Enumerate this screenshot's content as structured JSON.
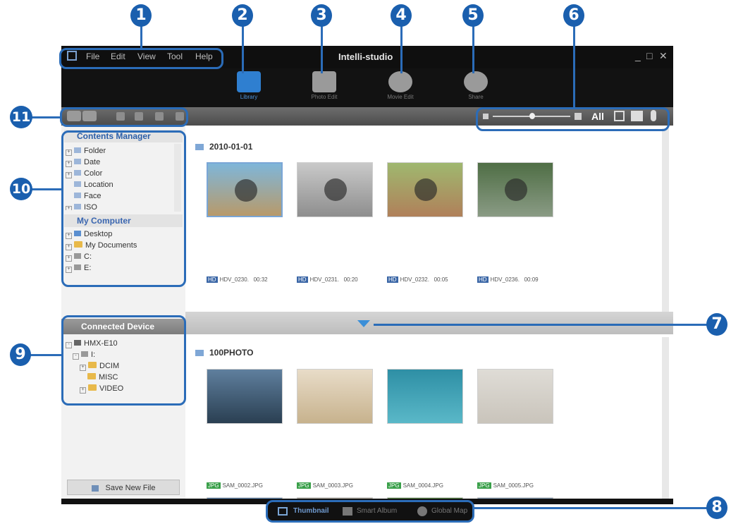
{
  "menu": {
    "items": [
      "File",
      "Edit",
      "View",
      "Tool",
      "Help"
    ]
  },
  "window": {
    "title": "Intelli-studio"
  },
  "modes": [
    {
      "label": "Library",
      "icon": "library-icon",
      "color": "#2f7fd0"
    },
    {
      "label": "Photo Edit",
      "icon": "photo-edit-icon",
      "color": "#9a9a9a"
    },
    {
      "label": "Movie Edit",
      "icon": "movie-edit-icon",
      "color": "#9a9a9a"
    },
    {
      "label": "Share",
      "icon": "share-globe-icon",
      "color": "#9a9a9a"
    }
  ],
  "view_filter": {
    "all_label": "All"
  },
  "left": {
    "contents_manager": {
      "title": "Contents Manager",
      "items": [
        "Folder",
        "Date",
        "Color",
        "Location",
        "Face",
        "ISO"
      ]
    },
    "my_computer": {
      "title": "My Computer",
      "items": [
        "Desktop",
        "My Documents",
        "C:",
        "E:"
      ]
    },
    "connected_device": {
      "title": "Connected Device",
      "items": [
        "HMX-E10",
        "I:",
        "DCIM",
        "MISC",
        "VIDEO"
      ]
    },
    "save_label": "Save New File"
  },
  "groups": [
    {
      "title": "2010-01-01",
      "files": [
        {
          "name": "HDV_0230.",
          "dur": "00:32",
          "badge": "HD"
        },
        {
          "name": "HDV_0231.",
          "dur": "00:20",
          "badge": "HD"
        },
        {
          "name": "HDV_0232.",
          "dur": "00:05",
          "badge": "HD"
        },
        {
          "name": "HDV_0236.",
          "dur": "00:09",
          "badge": "HD"
        }
      ]
    },
    {
      "title": "100PHOTO",
      "files": [
        {
          "name": "SAM_0002.JPG"
        },
        {
          "name": "SAM_0003.JPG"
        },
        {
          "name": "SAM_0004.JPG"
        },
        {
          "name": "SAM_0005.JPG"
        }
      ]
    }
  ],
  "bottom_tabs": [
    "Thumbnail",
    "Smart Album",
    "Global Map"
  ],
  "callouts": [
    "1",
    "2",
    "3",
    "4",
    "5",
    "6",
    "7",
    "8",
    "9",
    "10",
    "11"
  ],
  "colors": {
    "window_bg": "#141414",
    "accent": "#2b6cb8",
    "toolbar": "#5c5c5c"
  }
}
